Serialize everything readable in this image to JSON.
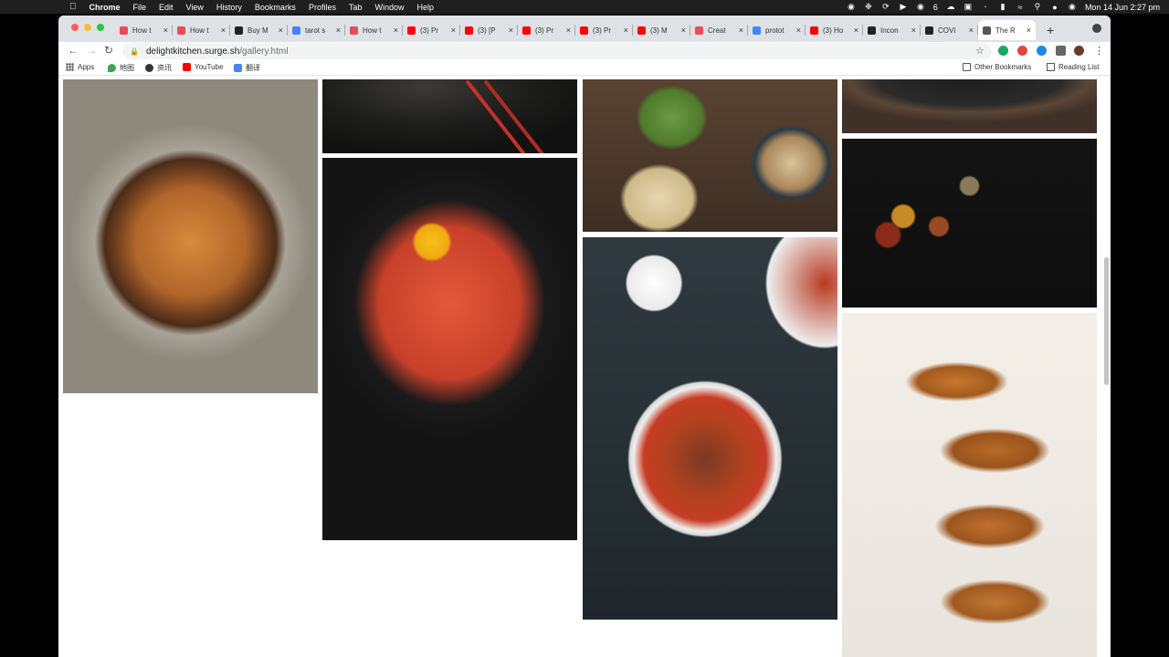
{
  "menubar": {
    "app": "Chrome",
    "items": [
      "File",
      "Edit",
      "View",
      "History",
      "Bookmarks",
      "Profiles",
      "Tab",
      "Window",
      "Help"
    ],
    "status_count": "6",
    "clock": "Mon 14 Jun  2:27 pm"
  },
  "tabs": [
    {
      "title": "How t",
      "color": "#e94b57"
    },
    {
      "title": "How t",
      "color": "#e94b57"
    },
    {
      "title": "Buy M",
      "color": "#222222"
    },
    {
      "title": "tarot s",
      "color": "#4285f4"
    },
    {
      "title": "How t",
      "color": "#e94b57"
    },
    {
      "title": "(3) Pr",
      "color": "#ff0000"
    },
    {
      "title": "(3) [P",
      "color": "#ff0000"
    },
    {
      "title": "(3) Pr",
      "color": "#ff0000"
    },
    {
      "title": "(3) Pr",
      "color": "#ff0000"
    },
    {
      "title": "(3) M",
      "color": "#ff0000"
    },
    {
      "title": "Creat",
      "color": "#e94b57"
    },
    {
      "title": "protot",
      "color": "#4285f4"
    },
    {
      "title": "(3) Ho",
      "color": "#ff0000"
    },
    {
      "title": "Incon",
      "color": "#222222"
    },
    {
      "title": "COVI",
      "color": "#222222"
    },
    {
      "title": "The R",
      "color": "#555555",
      "active": true
    }
  ],
  "toolbar": {
    "url_host": "delightkitchen.surge.sh",
    "url_path": "/gallery.html"
  },
  "bookmarks": {
    "apps": "Apps",
    "maps": "地图",
    "news": "资讯",
    "youtube": "YouTube",
    "translate": "翻译",
    "other": "Other Bookmarks",
    "reading": "Reading List"
  },
  "gallery": {
    "photos": [
      {
        "name": "chicken-bowl-photo"
      },
      {
        "name": "dark-plate-photo"
      },
      {
        "name": "kimchi-stew-photo"
      },
      {
        "name": "dumplings-platter-photo"
      },
      {
        "name": "beef-noodle-photo"
      },
      {
        "name": "slate-board-photo"
      },
      {
        "name": "spice-spoons-photo"
      },
      {
        "name": "potstickers-photo"
      }
    ]
  }
}
